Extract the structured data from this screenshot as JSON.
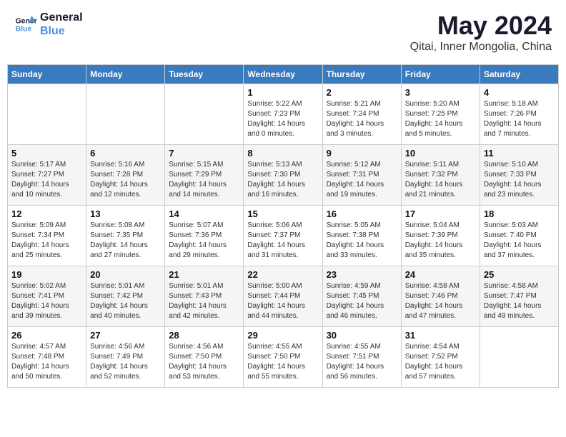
{
  "header": {
    "logo_line1": "General",
    "logo_line2": "Blue",
    "month": "May 2024",
    "location": "Qitai, Inner Mongolia, China"
  },
  "weekdays": [
    "Sunday",
    "Monday",
    "Tuesday",
    "Wednesday",
    "Thursday",
    "Friday",
    "Saturday"
  ],
  "weeks": [
    [
      {
        "day": "",
        "sunrise": "",
        "sunset": "",
        "daylight": ""
      },
      {
        "day": "",
        "sunrise": "",
        "sunset": "",
        "daylight": ""
      },
      {
        "day": "",
        "sunrise": "",
        "sunset": "",
        "daylight": ""
      },
      {
        "day": "1",
        "sunrise": "Sunrise: 5:22 AM",
        "sunset": "Sunset: 7:23 PM",
        "daylight": "Daylight: 14 hours and 0 minutes."
      },
      {
        "day": "2",
        "sunrise": "Sunrise: 5:21 AM",
        "sunset": "Sunset: 7:24 PM",
        "daylight": "Daylight: 14 hours and 3 minutes."
      },
      {
        "day": "3",
        "sunrise": "Sunrise: 5:20 AM",
        "sunset": "Sunset: 7:25 PM",
        "daylight": "Daylight: 14 hours and 5 minutes."
      },
      {
        "day": "4",
        "sunrise": "Sunrise: 5:18 AM",
        "sunset": "Sunset: 7:26 PM",
        "daylight": "Daylight: 14 hours and 7 minutes."
      }
    ],
    [
      {
        "day": "5",
        "sunrise": "Sunrise: 5:17 AM",
        "sunset": "Sunset: 7:27 PM",
        "daylight": "Daylight: 14 hours and 10 minutes."
      },
      {
        "day": "6",
        "sunrise": "Sunrise: 5:16 AM",
        "sunset": "Sunset: 7:28 PM",
        "daylight": "Daylight: 14 hours and 12 minutes."
      },
      {
        "day": "7",
        "sunrise": "Sunrise: 5:15 AM",
        "sunset": "Sunset: 7:29 PM",
        "daylight": "Daylight: 14 hours and 14 minutes."
      },
      {
        "day": "8",
        "sunrise": "Sunrise: 5:13 AM",
        "sunset": "Sunset: 7:30 PM",
        "daylight": "Daylight: 14 hours and 16 minutes."
      },
      {
        "day": "9",
        "sunrise": "Sunrise: 5:12 AM",
        "sunset": "Sunset: 7:31 PM",
        "daylight": "Daylight: 14 hours and 19 minutes."
      },
      {
        "day": "10",
        "sunrise": "Sunrise: 5:11 AM",
        "sunset": "Sunset: 7:32 PM",
        "daylight": "Daylight: 14 hours and 21 minutes."
      },
      {
        "day": "11",
        "sunrise": "Sunrise: 5:10 AM",
        "sunset": "Sunset: 7:33 PM",
        "daylight": "Daylight: 14 hours and 23 minutes."
      }
    ],
    [
      {
        "day": "12",
        "sunrise": "Sunrise: 5:09 AM",
        "sunset": "Sunset: 7:34 PM",
        "daylight": "Daylight: 14 hours and 25 minutes."
      },
      {
        "day": "13",
        "sunrise": "Sunrise: 5:08 AM",
        "sunset": "Sunset: 7:35 PM",
        "daylight": "Daylight: 14 hours and 27 minutes."
      },
      {
        "day": "14",
        "sunrise": "Sunrise: 5:07 AM",
        "sunset": "Sunset: 7:36 PM",
        "daylight": "Daylight: 14 hours and 29 minutes."
      },
      {
        "day": "15",
        "sunrise": "Sunrise: 5:06 AM",
        "sunset": "Sunset: 7:37 PM",
        "daylight": "Daylight: 14 hours and 31 minutes."
      },
      {
        "day": "16",
        "sunrise": "Sunrise: 5:05 AM",
        "sunset": "Sunset: 7:38 PM",
        "daylight": "Daylight: 14 hours and 33 minutes."
      },
      {
        "day": "17",
        "sunrise": "Sunrise: 5:04 AM",
        "sunset": "Sunset: 7:39 PM",
        "daylight": "Daylight: 14 hours and 35 minutes."
      },
      {
        "day": "18",
        "sunrise": "Sunrise: 5:03 AM",
        "sunset": "Sunset: 7:40 PM",
        "daylight": "Daylight: 14 hours and 37 minutes."
      }
    ],
    [
      {
        "day": "19",
        "sunrise": "Sunrise: 5:02 AM",
        "sunset": "Sunset: 7:41 PM",
        "daylight": "Daylight: 14 hours and 39 minutes."
      },
      {
        "day": "20",
        "sunrise": "Sunrise: 5:01 AM",
        "sunset": "Sunset: 7:42 PM",
        "daylight": "Daylight: 14 hours and 40 minutes."
      },
      {
        "day": "21",
        "sunrise": "Sunrise: 5:01 AM",
        "sunset": "Sunset: 7:43 PM",
        "daylight": "Daylight: 14 hours and 42 minutes."
      },
      {
        "day": "22",
        "sunrise": "Sunrise: 5:00 AM",
        "sunset": "Sunset: 7:44 PM",
        "daylight": "Daylight: 14 hours and 44 minutes."
      },
      {
        "day": "23",
        "sunrise": "Sunrise: 4:59 AM",
        "sunset": "Sunset: 7:45 PM",
        "daylight": "Daylight: 14 hours and 46 minutes."
      },
      {
        "day": "24",
        "sunrise": "Sunrise: 4:58 AM",
        "sunset": "Sunset: 7:46 PM",
        "daylight": "Daylight: 14 hours and 47 minutes."
      },
      {
        "day": "25",
        "sunrise": "Sunrise: 4:58 AM",
        "sunset": "Sunset: 7:47 PM",
        "daylight": "Daylight: 14 hours and 49 minutes."
      }
    ],
    [
      {
        "day": "26",
        "sunrise": "Sunrise: 4:57 AM",
        "sunset": "Sunset: 7:48 PM",
        "daylight": "Daylight: 14 hours and 50 minutes."
      },
      {
        "day": "27",
        "sunrise": "Sunrise: 4:56 AM",
        "sunset": "Sunset: 7:49 PM",
        "daylight": "Daylight: 14 hours and 52 minutes."
      },
      {
        "day": "28",
        "sunrise": "Sunrise: 4:56 AM",
        "sunset": "Sunset: 7:50 PM",
        "daylight": "Daylight: 14 hours and 53 minutes."
      },
      {
        "day": "29",
        "sunrise": "Sunrise: 4:55 AM",
        "sunset": "Sunset: 7:50 PM",
        "daylight": "Daylight: 14 hours and 55 minutes."
      },
      {
        "day": "30",
        "sunrise": "Sunrise: 4:55 AM",
        "sunset": "Sunset: 7:51 PM",
        "daylight": "Daylight: 14 hours and 56 minutes."
      },
      {
        "day": "31",
        "sunrise": "Sunrise: 4:54 AM",
        "sunset": "Sunset: 7:52 PM",
        "daylight": "Daylight: 14 hours and 57 minutes."
      },
      {
        "day": "",
        "sunrise": "",
        "sunset": "",
        "daylight": ""
      }
    ]
  ]
}
